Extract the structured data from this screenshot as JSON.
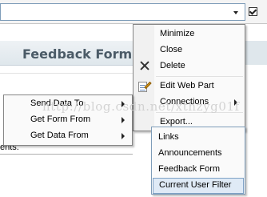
{
  "main_menu": {
    "items": [
      "Minimize",
      "Close",
      "Delete",
      "Edit Web Part",
      "Connections",
      "Export..."
    ]
  },
  "connections_menu": {
    "items": [
      "Send Data To",
      "Get Form From",
      "Get Data From"
    ]
  },
  "data_menu": {
    "items": [
      "Links",
      "Announcements",
      "Feedback Form",
      "Current User Filter"
    ],
    "highlighted": "Current User Filter"
  },
  "webpart": {
    "title": "Feedback Form",
    "body_text": "ents."
  },
  "watermark": "http://blog.csdn.net/xthzyg01f",
  "icons": {
    "delete": "close-x-icon",
    "edit": "edit-web-part-icon",
    "dropdown": "chevron-down-icon",
    "checkbox": "checkbox-checked-icon"
  },
  "colors": {
    "highlight_bg": "#dfeaf6",
    "highlight_border": "#7fa2c6",
    "title_color": "#4b5b67"
  }
}
